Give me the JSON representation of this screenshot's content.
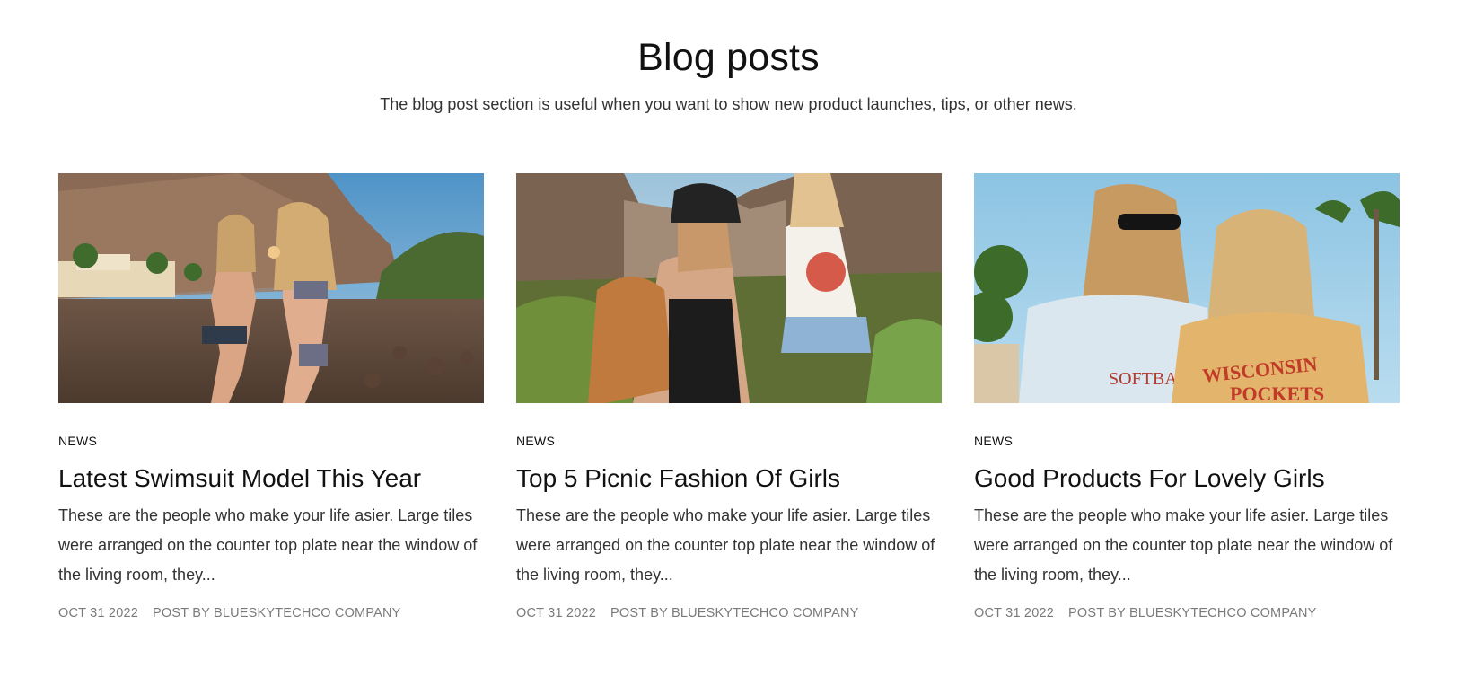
{
  "section": {
    "title": "Blog posts",
    "subtitle": "The blog post section is useful when you want to show new product launches, tips, or other news."
  },
  "posts": [
    {
      "category": "NEWS",
      "title": "Latest Swimsuit Model This Year",
      "excerpt": "These are the people who make your life asier. Large tiles were arranged on the counter top plate near the window of the living room, they...",
      "date": "OCT 31 2022",
      "author": "POST BY BLUESKYTECHCO COMPANY",
      "image": "two-women-swimsuits-beach-photo"
    },
    {
      "category": "NEWS",
      "title": "Top 5 Picnic Fashion Of Girls",
      "excerpt": "These are the people who make your life asier. Large tiles were arranged on the counter top plate near the window of the living room, they...",
      "date": "OCT 31 2022",
      "author": "POST BY BLUESKYTECHCO COMPANY",
      "image": "two-women-mountain-picnic-photo"
    },
    {
      "category": "NEWS",
      "title": "Good Products For Lovely Girls",
      "excerpt": "These are the people who make your life asier. Large tiles were arranged on the counter top plate near the window of the living room, they...",
      "date": "OCT 31 2022",
      "author": "POST BY BLUESKYTECHCO COMPANY",
      "image": "two-women-sweatshirts-palms-photo"
    }
  ]
}
